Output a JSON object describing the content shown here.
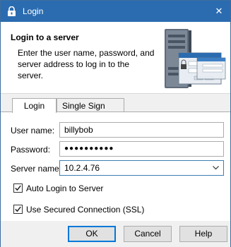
{
  "window": {
    "title": "Login",
    "close_glyph": "✕"
  },
  "header": {
    "heading": "Login to a server",
    "description": "Enter the user name, password, and server address to log in to the server.",
    "illustration_icon": "server-login-illustration"
  },
  "tabs": [
    {
      "label": "Login",
      "active": true
    },
    {
      "label": "Single Sign On",
      "active": false
    }
  ],
  "form": {
    "username_label": "User name:",
    "username_value": "billybob",
    "password_label": "Password:",
    "password_value": "●●●●●●●●●●",
    "server_label": "Server name:",
    "server_value": "10.2.4.76",
    "auto_login_label": "Auto Login to Server",
    "auto_login_checked": true,
    "ssl_label": "Use Secured Connection (SSL)",
    "ssl_checked": true
  },
  "buttons": {
    "ok": "OK",
    "cancel": "Cancel",
    "help": "Help"
  },
  "colors": {
    "titlebar": "#2b6cb0",
    "focus_border": "#3c7fb1",
    "default_button": "#0078d7"
  }
}
